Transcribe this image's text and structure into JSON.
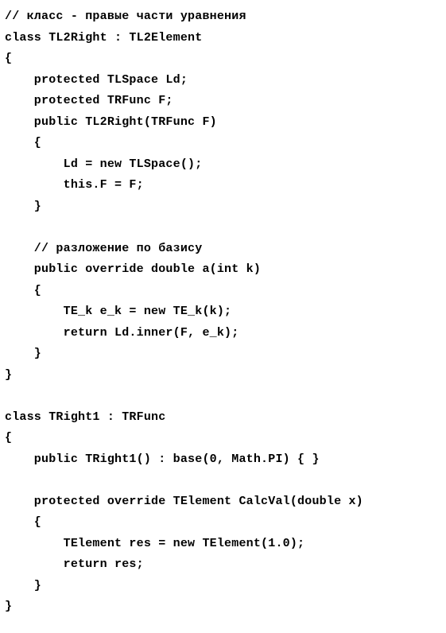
{
  "code": {
    "lines": [
      "// класс - правые части уравнения",
      "class TL2Right : TL2Element",
      "{",
      "    protected TLSpace Ld;",
      "    protected TRFunc F;",
      "    public TL2Right(TRFunc F)",
      "    {",
      "        Ld = new TLSpace();",
      "        this.F = F;",
      "    }",
      "",
      "    // разложение по базису",
      "    public override double a(int k)",
      "    {",
      "        TE_k e_k = new TE_k(k);",
      "        return Ld.inner(F, e_k);",
      "    }",
      "}",
      "",
      "class TRight1 : TRFunc",
      "{",
      "    public TRight1() : base(0, Math.PI) { }",
      "",
      "    protected override TElement CalcVal(double x)",
      "    {",
      "        TElement res = new TElement(1.0);",
      "        return res;",
      "    }",
      "}"
    ]
  }
}
